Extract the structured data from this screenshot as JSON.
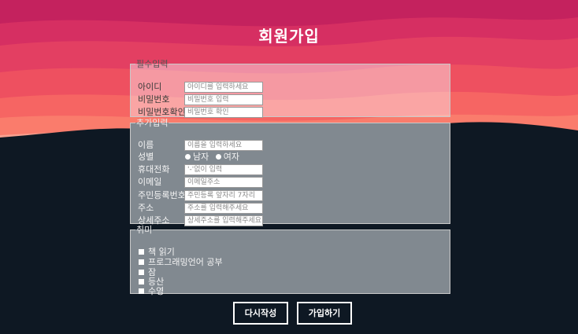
{
  "page": {
    "title": "회원가입"
  },
  "required_section": {
    "legend": "필수입력",
    "fields": [
      {
        "label": "아이디",
        "placeholder": "아이디를 입력하세요"
      },
      {
        "label": "비밀번호",
        "placeholder": "비밀번호 입력"
      },
      {
        "label": "비밀번호확인",
        "placeholder": "비밀번호 확인"
      }
    ]
  },
  "extra_section": {
    "legend": "추가입력",
    "name": {
      "label": "이름",
      "placeholder": "이름을 입력하세요"
    },
    "gender": {
      "label": "성별",
      "options": [
        "남자",
        "여자"
      ]
    },
    "phone": {
      "label": "휴대전화",
      "placeholder": "'-'없이 입력"
    },
    "email": {
      "label": "이메일",
      "placeholder": "이메일주소"
    },
    "ssn": {
      "label": "주민등록번호",
      "placeholder": "주민등록 앞자리 7자리"
    },
    "address": {
      "label": "주소",
      "placeholder": "주소를 입력해주세요"
    },
    "address_detail": {
      "label": "상세주소",
      "placeholder": "상세주소를 입력해주세요"
    }
  },
  "hobby_section": {
    "legend": "취미",
    "items": [
      "책 읽기",
      "프로그래밍언어 공부",
      "잠",
      "등산",
      "수영"
    ]
  },
  "buttons": {
    "reset": "다시작성",
    "submit": "가입하기"
  },
  "colors": {
    "background": "#0e1823",
    "sky_top": "#c4225e",
    "sky_mid": "#ee5060",
    "sky_low": "#fa7c6c",
    "panel": "#818990"
  }
}
